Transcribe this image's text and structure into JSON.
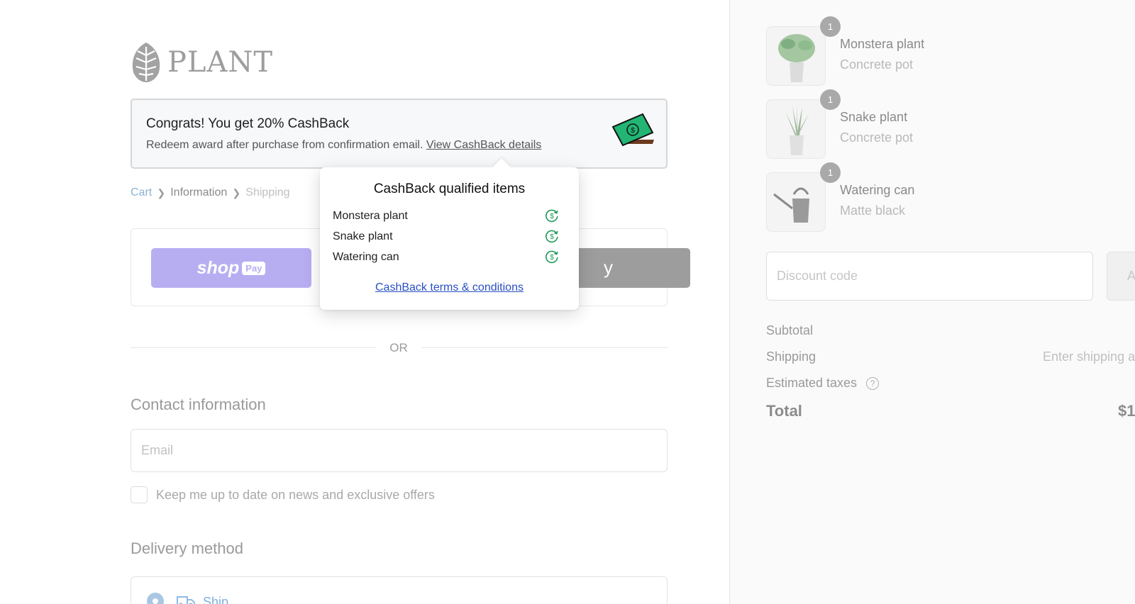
{
  "brand": {
    "name": "PLANT"
  },
  "cashback_banner": {
    "title": "Congrats! You get 20% CashBack",
    "subtitle": "Redeem award after purchase from confirmation email.",
    "link": "View CashBack details"
  },
  "breadcrumb": {
    "cart": "Cart",
    "information": "Information",
    "shipping": "Shipping"
  },
  "express": {
    "shop_word": "shop",
    "shop_pay_badge": "Pay",
    "gpay_visible_text": "y"
  },
  "divider": {
    "or": "OR"
  },
  "contact": {
    "title": "Contact information",
    "email_placeholder": "Email",
    "newsletter_label": "Keep me up to date on news and exclusive offers"
  },
  "delivery": {
    "title": "Delivery method",
    "ship_label": "Ship"
  },
  "popover": {
    "title": "CashBack qualified items",
    "items": [
      "Monstera plant",
      "Snake plant",
      "Watering can"
    ],
    "terms_link": "CashBack terms & conditions"
  },
  "summary": {
    "items": [
      {
        "name": "Monstera plant",
        "variant": "Concrete pot",
        "quantity": "1"
      },
      {
        "name": "Snake plant",
        "variant": "Concrete pot",
        "quantity": "1"
      },
      {
        "name": "Watering can",
        "variant": "Matte black",
        "quantity": "1"
      }
    ],
    "discount_placeholder": "Discount code",
    "apply_visible": "A",
    "subtotal_label": "Subtotal",
    "shipping_label": "Shipping",
    "shipping_value": "Enter shipping a",
    "taxes_label": "Estimated taxes",
    "total_label": "Total",
    "total_value": "$1"
  },
  "colors": {
    "shop_pay": "#b7aef2",
    "link_blue": "#2a50c2",
    "cashback_green": "#1f9a5a",
    "breadcrumb_active": "#8ab3d6"
  },
  "icons": [
    "leaf-logo-icon",
    "money-icon",
    "chevron-right-icon",
    "coin-icon",
    "help-icon",
    "truck-icon"
  ]
}
